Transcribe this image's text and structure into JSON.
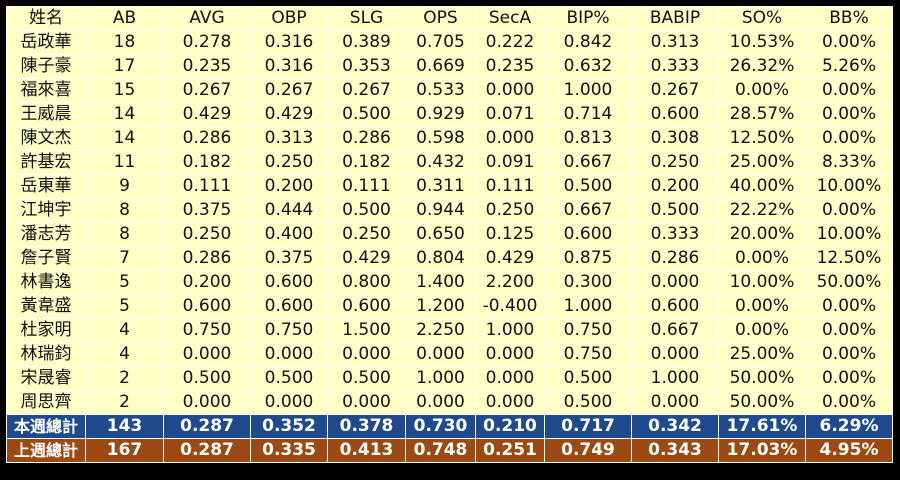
{
  "headers": [
    "姓名",
    "AB",
    "AVG",
    "OBP",
    "SLG",
    "OPS",
    "SecA",
    "BIP%",
    "BABIP",
    "SO%",
    "BB%"
  ],
  "rows": [
    [
      "岳政華",
      "18",
      "0.278",
      "0.316",
      "0.389",
      "0.705",
      "0.222",
      "0.842",
      "0.313",
      "10.53%",
      "0.00%"
    ],
    [
      "陳子豪",
      "17",
      "0.235",
      "0.316",
      "0.353",
      "0.669",
      "0.235",
      "0.632",
      "0.333",
      "26.32%",
      "5.26%"
    ],
    [
      "福來喜",
      "15",
      "0.267",
      "0.267",
      "0.267",
      "0.533",
      "0.000",
      "1.000",
      "0.267",
      "0.00%",
      "0.00%"
    ],
    [
      "王威晨",
      "14",
      "0.429",
      "0.429",
      "0.500",
      "0.929",
      "0.071",
      "0.714",
      "0.600",
      "28.57%",
      "0.00%"
    ],
    [
      "陳文杰",
      "14",
      "0.286",
      "0.313",
      "0.286",
      "0.598",
      "0.000",
      "0.813",
      "0.308",
      "12.50%",
      "0.00%"
    ],
    [
      "許基宏",
      "11",
      "0.182",
      "0.250",
      "0.182",
      "0.432",
      "0.091",
      "0.667",
      "0.250",
      "25.00%",
      "8.33%"
    ],
    [
      "岳東華",
      "9",
      "0.111",
      "0.200",
      "0.111",
      "0.311",
      "0.111",
      "0.500",
      "0.200",
      "40.00%",
      "10.00%"
    ],
    [
      "江坤宇",
      "8",
      "0.375",
      "0.444",
      "0.500",
      "0.944",
      "0.250",
      "0.667",
      "0.500",
      "22.22%",
      "0.00%"
    ],
    [
      "潘志芳",
      "8",
      "0.250",
      "0.400",
      "0.250",
      "0.650",
      "0.125",
      "0.600",
      "0.333",
      "20.00%",
      "10.00%"
    ],
    [
      "詹子賢",
      "7",
      "0.286",
      "0.375",
      "0.429",
      "0.804",
      "0.429",
      "0.875",
      "0.286",
      "0.00%",
      "12.50%"
    ],
    [
      "林書逸",
      "5",
      "0.200",
      "0.600",
      "0.800",
      "1.400",
      "2.200",
      "0.300",
      "0.000",
      "10.00%",
      "50.00%"
    ],
    [
      "黃韋盛",
      "5",
      "0.600",
      "0.600",
      "0.600",
      "1.200",
      "-0.400",
      "1.000",
      "0.600",
      "0.00%",
      "0.00%"
    ],
    [
      "杜家明",
      "4",
      "0.750",
      "0.750",
      "1.500",
      "2.250",
      "1.000",
      "0.750",
      "0.667",
      "0.00%",
      "0.00%"
    ],
    [
      "林瑞鈞",
      "4",
      "0.000",
      "0.000",
      "0.000",
      "0.000",
      "0.000",
      "0.750",
      "0.000",
      "25.00%",
      "0.00%"
    ],
    [
      "宋晟睿",
      "2",
      "0.500",
      "0.500",
      "0.500",
      "1.000",
      "0.000",
      "0.500",
      "1.000",
      "50.00%",
      "0.00%"
    ],
    [
      "周思齊",
      "2",
      "0.000",
      "0.000",
      "0.000",
      "0.000",
      "0.000",
      "0.500",
      "0.000",
      "50.00%",
      "0.00%"
    ]
  ],
  "totals": [
    {
      "kind": "this",
      "cells": [
        "本週總計",
        "143",
        "0.287",
        "0.352",
        "0.378",
        "0.730",
        "0.210",
        "0.717",
        "0.342",
        "17.61%",
        "6.29%"
      ]
    },
    {
      "kind": "last",
      "cells": [
        "上週總計",
        "167",
        "0.287",
        "0.335",
        "0.413",
        "0.748",
        "0.251",
        "0.749",
        "0.343",
        "17.03%",
        "4.95%"
      ]
    }
  ],
  "colors": {
    "cell_bg": "#ffffc6",
    "this_week_bg": "#1f4b8e",
    "last_week_bg": "#9c4a12"
  }
}
